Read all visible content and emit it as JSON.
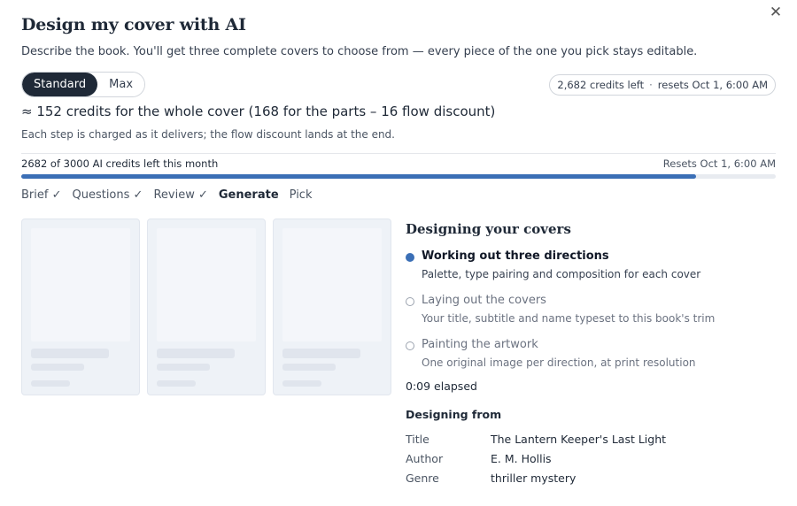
{
  "dialog": {
    "title": "Design my cover with AI",
    "close_glyph": "✕",
    "subtitle": "Describe the book. You'll get three complete covers to choose from — every piece of the one you pick stays editable."
  },
  "mode": {
    "options": [
      "Standard",
      "Max"
    ],
    "selected": "Standard"
  },
  "credits_pill": {
    "left": "2,682 credits left",
    "separator": "·",
    "resets": "resets Oct 1, 6:00 AM"
  },
  "estimate": {
    "headline": "≈ 152 credits for the whole cover (168 for the parts – 16 flow discount)",
    "note": "Each step is charged as it delivers; the flow discount lands at the end."
  },
  "meter": {
    "label": "2682 of 3000 AI credits left this month",
    "resets": "Resets Oct 1, 6:00 AM",
    "used": 2682,
    "total": 3000,
    "fill_color": "#3b6fb6"
  },
  "steps": [
    {
      "label": "Brief ✓",
      "state": "done"
    },
    {
      "label": "Questions ✓",
      "state": "done"
    },
    {
      "label": "Review ✓",
      "state": "done"
    },
    {
      "label": "Generate",
      "state": "current"
    },
    {
      "label": "Pick",
      "state": "todo"
    }
  ],
  "panel": {
    "title": "Designing your covers",
    "phases": [
      {
        "title": "Working out three directions",
        "desc": "Palette, type pairing and composition for each cover",
        "state": "active"
      },
      {
        "title": "Laying out the covers",
        "desc": "Your title, subtitle and name typeset to this book's trim",
        "state": "pending"
      },
      {
        "title": "Painting the artwork",
        "desc": "One original image per direction, at print resolution",
        "state": "pending"
      }
    ],
    "elapsed": "0:09 elapsed",
    "from_title": "Designing from",
    "details": [
      {
        "key": "Title",
        "value": "The Lantern Keeper's Last Light"
      },
      {
        "key": "Author",
        "value": "E. M. Hollis"
      },
      {
        "key": "Genre",
        "value": "thriller mystery"
      }
    ]
  },
  "colors": {
    "accent": "#3b6fb6",
    "dark": "#1f2937",
    "placeholder": "#eef2f7"
  }
}
